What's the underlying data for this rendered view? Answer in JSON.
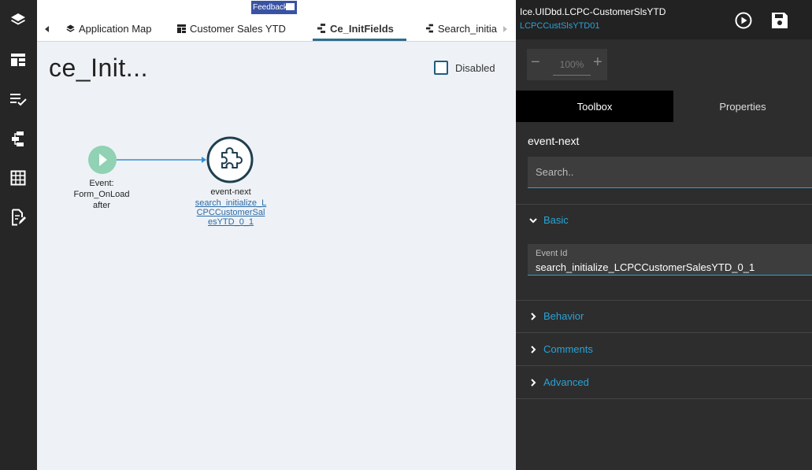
{
  "rail": {
    "icons": [
      "layers-icon",
      "layout-icon",
      "checklist-icon",
      "flow-icon",
      "grid-icon",
      "edit-document-icon"
    ]
  },
  "tabs": {
    "feedback": "Feedback",
    "items": [
      {
        "label": "Application Map"
      },
      {
        "label": "Customer Sales YTD"
      },
      {
        "label": "Ce_InitFields"
      },
      {
        "label": "Search_initia"
      }
    ]
  },
  "canvas": {
    "title": "ce_Init...",
    "disabled_label": "Disabled",
    "start_node": {
      "label_1": "Event:",
      "label_2": "Form_OnLoad",
      "label_3": "after"
    },
    "event_node": {
      "label": "event-next",
      "link": "search_initialize_LCPCCustomerSalesYTD_0_1"
    },
    "colors": {
      "start": "#90d2b3",
      "event_ring": "#1f3f4f",
      "connector": "#2e8fd8"
    }
  },
  "panel": {
    "title": "Ice.UIDbd.LCPC-CustomerSlsYTD",
    "subtitle": "LCPCCustSlsYTD01",
    "zoom": {
      "minus": "−",
      "value": "100%",
      "plus": "+"
    },
    "tabs": {
      "toolbox": "Toolbox",
      "properties": "Properties"
    },
    "section_title": "event-next",
    "search_placeholder": "Search..",
    "basic": "Basic",
    "event_id_label": "Event Id",
    "event_id_value": "search_initialize_LCPCCustomerSalesYTD_0_1",
    "behavior": "Behavior",
    "comments": "Comments",
    "advanced": "Advanced",
    "accent": "#29a3d6"
  }
}
